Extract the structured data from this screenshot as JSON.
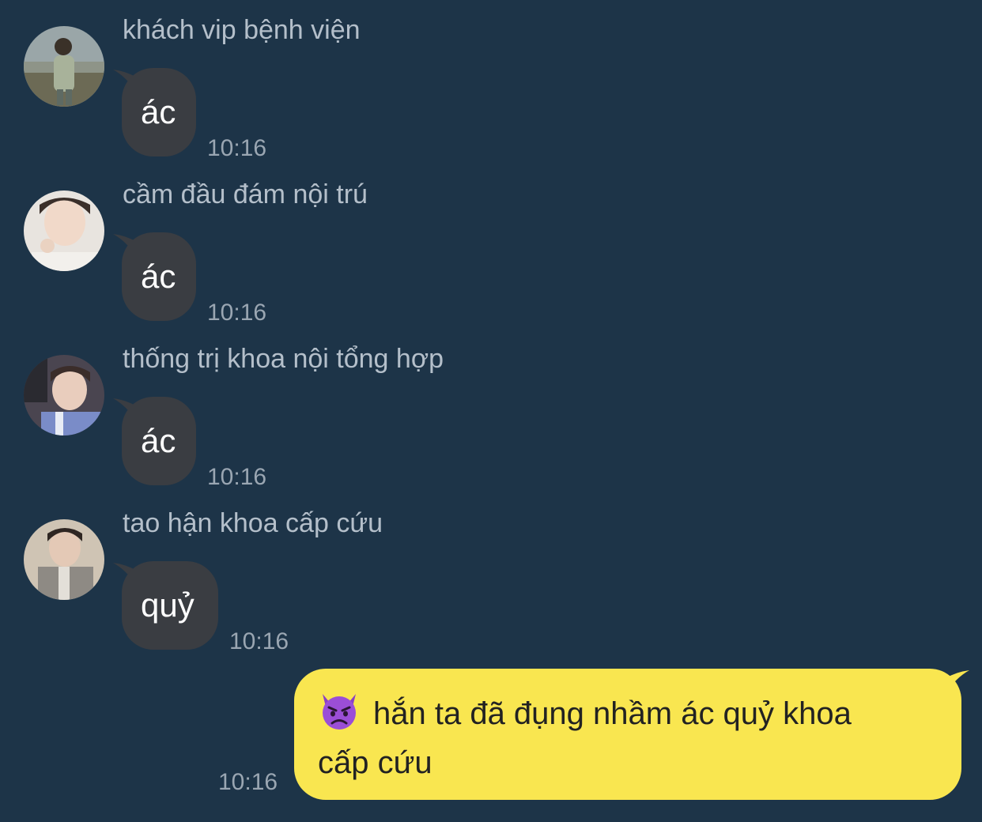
{
  "chat": {
    "messages": [
      {
        "sender": "khách vip bệnh viện",
        "text": "ác",
        "time": "10:16",
        "avatar": "avatar-1"
      },
      {
        "sender": "cầm đầu đám nội trú",
        "text": "ác",
        "time": "10:16",
        "avatar": "avatar-2"
      },
      {
        "sender": "thống trị khoa nội tổng hợp",
        "text": "ác",
        "time": "10:16",
        "avatar": "avatar-3"
      },
      {
        "sender": "tao hận khoa cấp cứu",
        "text": "quỷ",
        "time": "10:16",
        "avatar": "avatar-4"
      }
    ],
    "outgoing": {
      "emoji_icon": "angry-devil-emoji-icon",
      "line1": "hắn ta đã đụng nhầm ác quỷ khoa",
      "line2": "cấp cứu",
      "time": "10:16"
    }
  },
  "colors": {
    "background": "#1d3448",
    "incoming_bubble": "#3a3d42",
    "outgoing_bubble": "#f9e650",
    "sender_name": "#b4bfca",
    "timestamp": "#9aa6b2"
  }
}
